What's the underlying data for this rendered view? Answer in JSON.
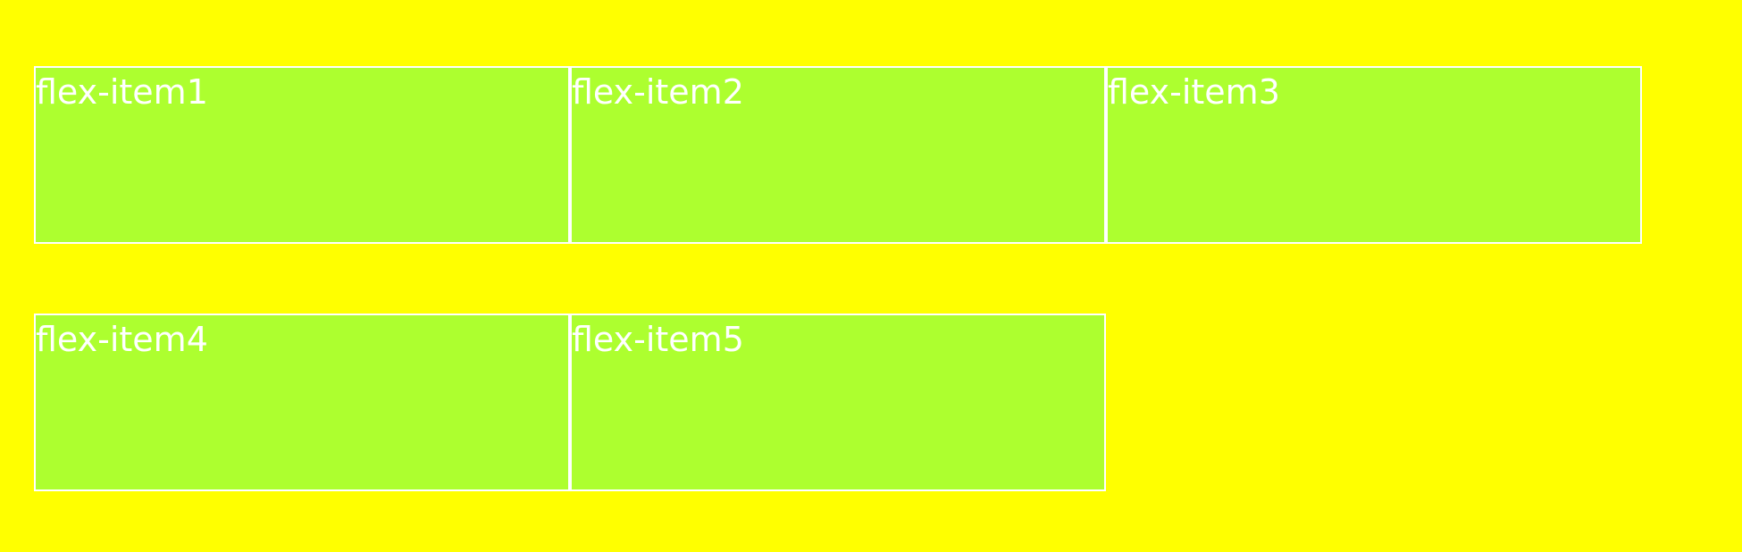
{
  "items": [
    {
      "label": "flex-item1"
    },
    {
      "label": "flex-item2"
    },
    {
      "label": "flex-item3"
    },
    {
      "label": "flex-item4"
    },
    {
      "label": "flex-item5"
    }
  ],
  "colors": {
    "background": "#ffff00",
    "item_fill": "#adff2f",
    "item_border": "#ffffff",
    "item_text": "#ffffff"
  }
}
